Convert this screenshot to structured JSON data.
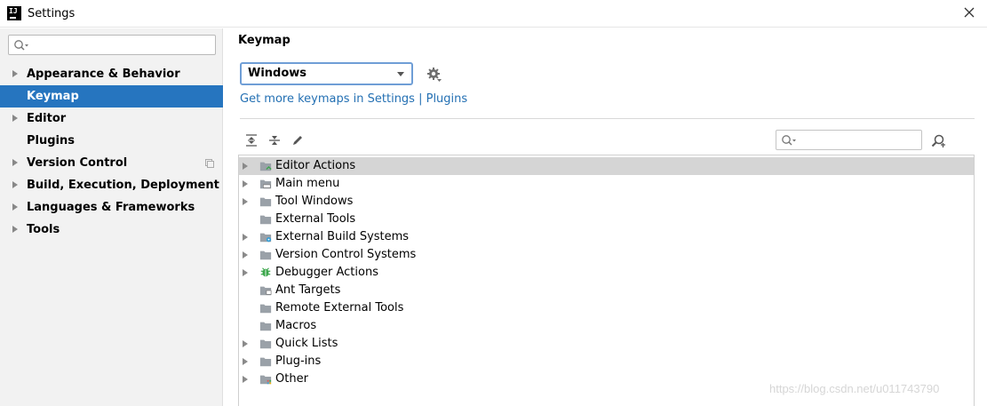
{
  "window": {
    "title": "Settings",
    "logo_text": "IJ"
  },
  "sidebar": {
    "search_placeholder": "",
    "items": [
      {
        "label": "Appearance & Behavior",
        "expandable": true
      },
      {
        "label": "Keymap",
        "selected": true
      },
      {
        "label": "Editor",
        "expandable": true
      },
      {
        "label": "Plugins"
      },
      {
        "label": "Version Control",
        "expandable": true
      },
      {
        "label": "Build, Execution, Deployment",
        "expandable": true
      },
      {
        "label": "Languages & Frameworks",
        "expandable": true
      },
      {
        "label": "Tools",
        "expandable": true
      }
    ]
  },
  "main": {
    "title": "Keymap",
    "keymap_value": "Windows",
    "more_link": "Get more keymaps in Settings | Plugins",
    "filter_placeholder": "",
    "tree": [
      {
        "label": "Editor Actions",
        "expandable": true,
        "selected": true,
        "icon": "editor-actions-folder-icon"
      },
      {
        "label": "Main menu",
        "expandable": true,
        "icon": "main-menu-folder-icon"
      },
      {
        "label": "Tool Windows",
        "expandable": true,
        "icon": "folder-icon"
      },
      {
        "label": "External Tools",
        "expandable": false,
        "icon": "folder-icon"
      },
      {
        "label": "External Build Systems",
        "expandable": true,
        "icon": "build-systems-folder-icon"
      },
      {
        "label": "Version Control Systems",
        "expandable": true,
        "icon": "folder-icon"
      },
      {
        "label": "Debugger Actions",
        "expandable": true,
        "icon": "bug-icon"
      },
      {
        "label": "Ant Targets",
        "expandable": false,
        "icon": "ant-folder-icon"
      },
      {
        "label": "Remote External Tools",
        "expandable": false,
        "icon": "folder-icon"
      },
      {
        "label": "Macros",
        "expandable": false,
        "icon": "folder-icon"
      },
      {
        "label": "Quick Lists",
        "expandable": true,
        "icon": "folder-icon"
      },
      {
        "label": "Plug-ins",
        "expandable": true,
        "icon": "folder-icon"
      },
      {
        "label": "Other",
        "expandable": true,
        "icon": "other-folder-icon"
      }
    ]
  },
  "watermark": "https://blog.csdn.net/u011743790",
  "colors": {
    "selection": "#2675bf",
    "link": "#2470b3",
    "tree_selection": "#d5d5d5",
    "sidebar_bg": "#f2f2f2"
  }
}
